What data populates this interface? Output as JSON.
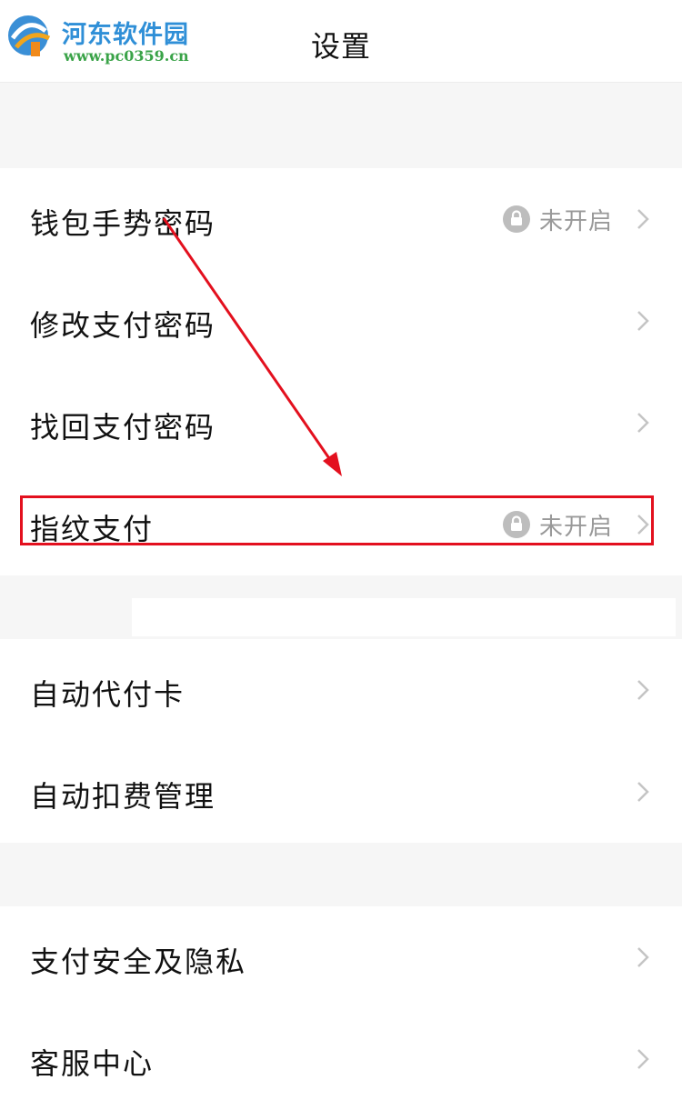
{
  "header": {
    "title": "设置"
  },
  "watermark": {
    "name": "河东软件园",
    "url": "www.pc0359.cn"
  },
  "groups": [
    {
      "items": [
        {
          "label": "钱包手势密码",
          "status": "未开启"
        },
        {
          "label": "修改支付密码"
        },
        {
          "label": "找回支付密码"
        },
        {
          "label": "指纹支付",
          "status": "未开启"
        }
      ]
    },
    {
      "items": [
        {
          "label": "自动代付卡"
        },
        {
          "label": "自动扣费管理"
        }
      ]
    },
    {
      "items": [
        {
          "label": "支付安全及隐私"
        },
        {
          "label": "客服中心"
        }
      ]
    }
  ],
  "colors": {
    "accent_annotation": "#e3101e",
    "text": "#111111",
    "muted": "#999999",
    "background": "#f6f6f6"
  }
}
